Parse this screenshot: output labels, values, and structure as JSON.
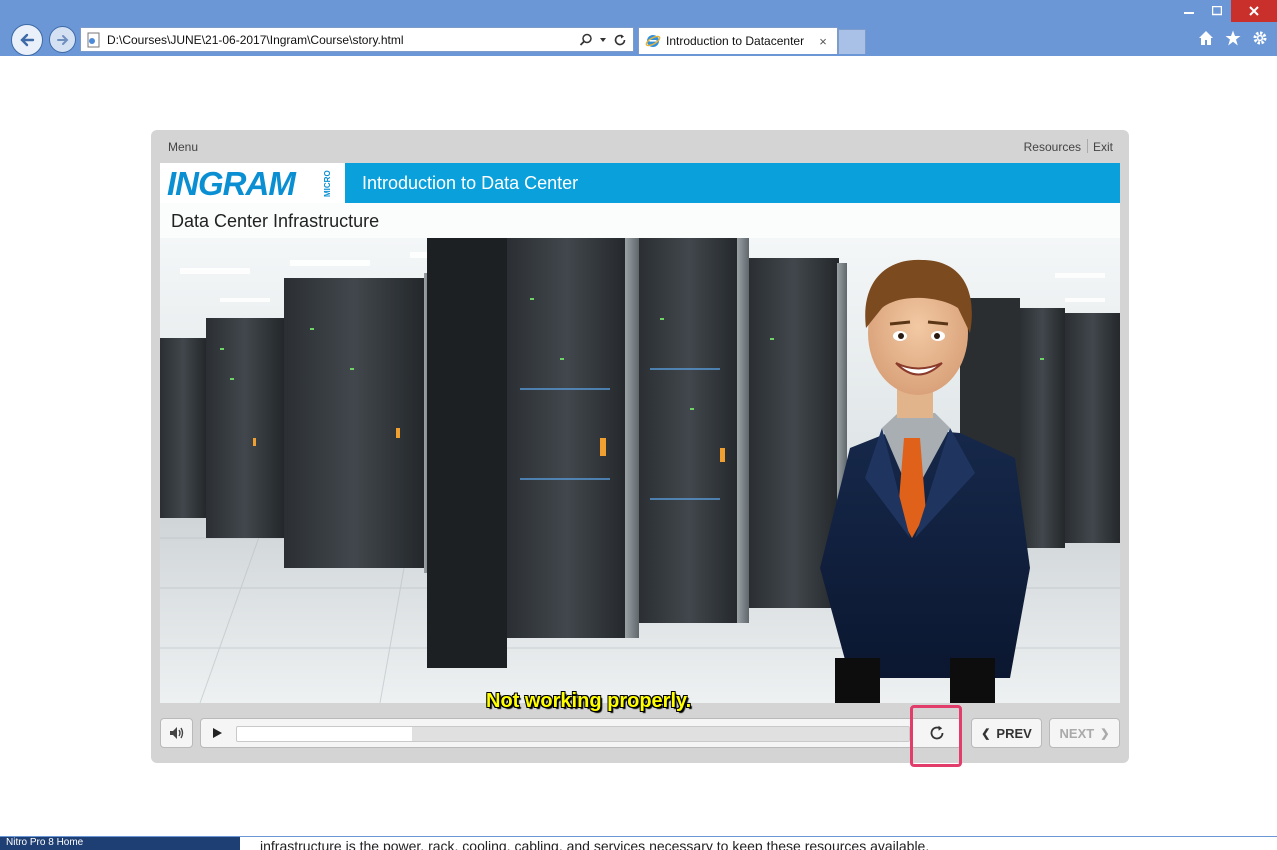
{
  "browser": {
    "address": "D:\\Courses\\JUNE\\21-06-2017\\Ingram\\Course\\story.html",
    "tab_title": "Introduction to Datacenter",
    "tab_close": "×",
    "win_minimize": "—",
    "win_maximize": "□",
    "win_close": "✕"
  },
  "player": {
    "menu_label": "Menu",
    "resources_label": "Resources",
    "exit_label": "Exit",
    "logo_text": "INGRAM",
    "logo_small": "MICRO",
    "course_title": "Introduction to Data Center",
    "slide_subtitle": "Data Center Infrastructure",
    "caption": "Not working properly.",
    "prev_label": "PREV",
    "next_label": "NEXT",
    "progress_fraction": 0.26
  },
  "bottom": {
    "taskbar_text": "Nitro Pro 8   Home",
    "cut_text": "infrastructure  is the power, rack, cooling, cabling, and services necessary to keep these resources available."
  },
  "colors": {
    "chrome": "#6b97d6",
    "header_blue": "#0aa0dc",
    "caption_yellow": "#ffff00",
    "highlight": "#e23c6a"
  },
  "icons": [
    "back-arrow-icon",
    "forward-arrow-icon",
    "page-icon",
    "search-icon",
    "refresh-icon",
    "ie-icon",
    "home-icon",
    "star-icon",
    "gear-icon",
    "volume-icon",
    "play-icon",
    "replay-icon"
  ]
}
